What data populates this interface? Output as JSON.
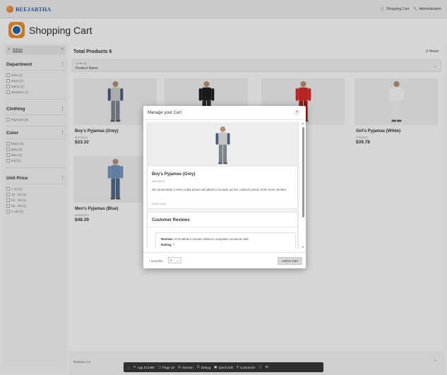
{
  "brand": {
    "name": "BEEJARTHA"
  },
  "topbar": {
    "cart_link": "Shopping Cart",
    "admin_link": "Administration"
  },
  "page": {
    "title": "Shopping Cart"
  },
  "search": {
    "value": "Admin"
  },
  "facets": [
    {
      "title": "Department",
      "items": [
        "Girls (2)",
        "Boys (1)",
        "Mens (1)",
        "Womens (1)"
      ]
    },
    {
      "title": "Clothing",
      "items": [
        "Pyjamas (6)"
      ]
    },
    {
      "title": "Color",
      "items": [
        "black (2)",
        "grey (2)",
        "blue (1)",
        "red (1)"
      ]
    },
    {
      "title": "Unit Price",
      "items": [
        "< 10 (1)",
        "10 - 20 (1)",
        "20 - 25 (1)",
        "25 - 35 (1)",
        ">=35 (2)"
      ]
    }
  ],
  "main": {
    "total": "Total Products 6",
    "reset": "Reset",
    "order_label": "Order By",
    "order_value": "Product Name"
  },
  "products": [
    {
      "name": "Boy's Pyjamas (Grey)",
      "sku": "BJTRACK",
      "price": "$23.32",
      "shirt": "#c4c4c4",
      "sleeve": "#4c5a78",
      "pants": "#7a8290"
    },
    {
      "name": "",
      "sku": "",
      "price": "",
      "shirt": "#1f1f1f",
      "sleeve": "#1f1f1f",
      "pants": "#2a2a2a"
    },
    {
      "name": "",
      "sku": "",
      "price": "",
      "shirt": "#d22a2a",
      "sleeve": "#d22a2a",
      "pants": "#a01e1e"
    },
    {
      "name": "Girl's Pyjamas (White)",
      "sku": "GTSHIRT",
      "price": "$39.78",
      "shirt": "#f2f2f2",
      "sleeve": "#f2f2f2",
      "pants": "#ececec"
    },
    {
      "name": "Men's Pyjamas (Blue)",
      "sku": "ADSHIRT3",
      "price": "$48.39",
      "shirt": "#6f8fb8",
      "sleeve": "#6f8fb8",
      "pants": "#4e6687"
    }
  ],
  "footer": {
    "release": "Release 1.0"
  },
  "devbar": [
    "App 213380",
    "Page 18",
    "Session",
    "Debug",
    "Quick Edit",
    "Customize"
  ],
  "dialog": {
    "title": "Manage your Cart",
    "product_name": "Boy's Pyjamas (Grey)",
    "sku": "BJTRACK",
    "description": "Sit consectetur Lorem culpa ipsum ad ullamco ea aute qui ea. Laboris ipsum enim enim veniam.",
    "price": "Price 23.32",
    "reviews_title": "Customer Reviews",
    "review_label": "Review:",
    "review_text": "Ut incididunt veniam ullamco voluptate occaecat velit.",
    "rating_label": "Rating:",
    "rating_value": "7",
    "quantity_label": "* Quantity",
    "quantity_value": "1",
    "add_button": "Add to Cart"
  }
}
